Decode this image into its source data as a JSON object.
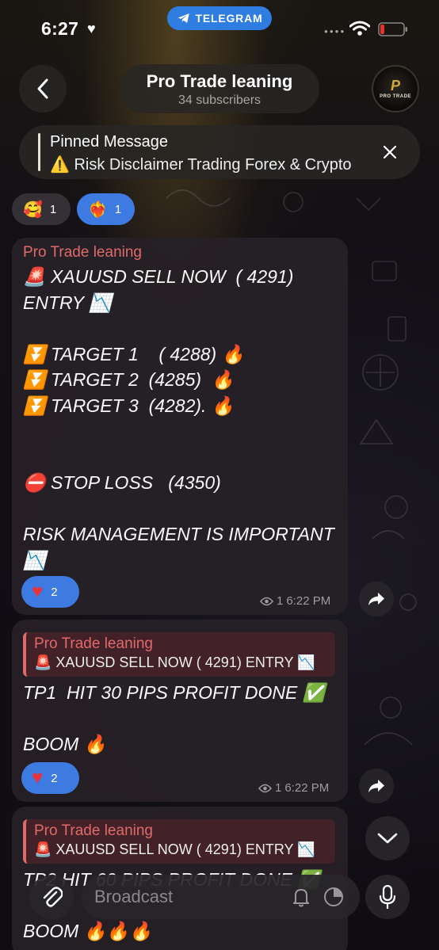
{
  "status_bar": {
    "time": "6:27",
    "app_badge": "TELEGRAM"
  },
  "header": {
    "title": "Pro Trade leaning",
    "subtitle": "34 subscribers",
    "avatar_mark": "P",
    "avatar_text": "PRO TRADE"
  },
  "pinned": {
    "title": "Pinned Message",
    "text": "⚠️ Risk Disclaimer Trading Forex & Crypto"
  },
  "top_reactions": [
    {
      "emoji": "🥰",
      "count": "1"
    },
    {
      "emoji": "❤️‍🔥",
      "count": "1"
    }
  ],
  "messages": [
    {
      "sender": "Pro Trade leaning",
      "text": "🚨 XAUUSD SELL NOW  ( 4291)\nENTRY 📉\n\n⏬ TARGET 1    ( 4288) 🔥\n⏬ TARGET 2  (4285)  🔥\n⏬ TARGET 3  (4282). 🔥\n\n\n⛔ STOP LOSS   (4350)\n\nRISK MANAGEMENT IS IMPORTANT\n📉",
      "reaction_count": "2",
      "views": "1",
      "time": "6:22 PM"
    },
    {
      "quote_name": "Pro Trade leaning",
      "quote_text": "🚨 XAUUSD SELL NOW ( 4291) ENTRY 📉",
      "text": "TP1  HIT 30 PIPS PROFIT DONE ✅\n\nBOOM 🔥",
      "reaction_count": "2",
      "views": "1",
      "time": "6:22 PM"
    },
    {
      "quote_name": "Pro Trade leaning",
      "quote_text": "🚨 XAUUSD SELL NOW ( 4291) ENTRY 📉",
      "text": "TP2 HIT 60 PIPS PROFIT DONE ✅\n\nBOOM 🔥🔥🔥"
    }
  ],
  "composer": {
    "placeholder": "Broadcast"
  },
  "colors": {
    "accent_blue": "#3d7be2",
    "sender_red": "#e06a6a",
    "bubble_bg": "#262126"
  }
}
